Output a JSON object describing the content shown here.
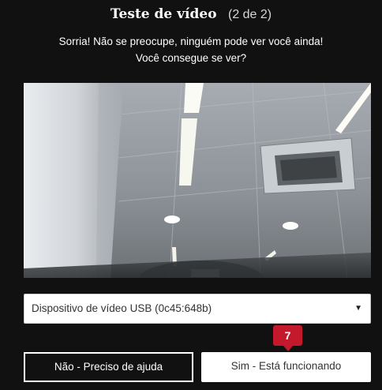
{
  "header": {
    "title": "Teste de vídeo",
    "step": "(2 de 2)"
  },
  "message": {
    "line1": "Sorria! Não se preocupe, ninguém pode ver você ainda!",
    "line2": "Você consegue se ver?"
  },
  "video_preview": {
    "icon": "camera-feed"
  },
  "device_select": {
    "selected": "Dispositivo de vídeo USB (0c45:648b)",
    "arrow": "▼"
  },
  "buttons": {
    "no_label": "Não - Preciso de ajuda",
    "yes_label": "Sim - Está funcionando"
  },
  "badge": {
    "count": "7",
    "color": "#c4182d"
  },
  "colors": {
    "background": "#111111",
    "text": "#ffffff",
    "accent": "#c4182d"
  }
}
